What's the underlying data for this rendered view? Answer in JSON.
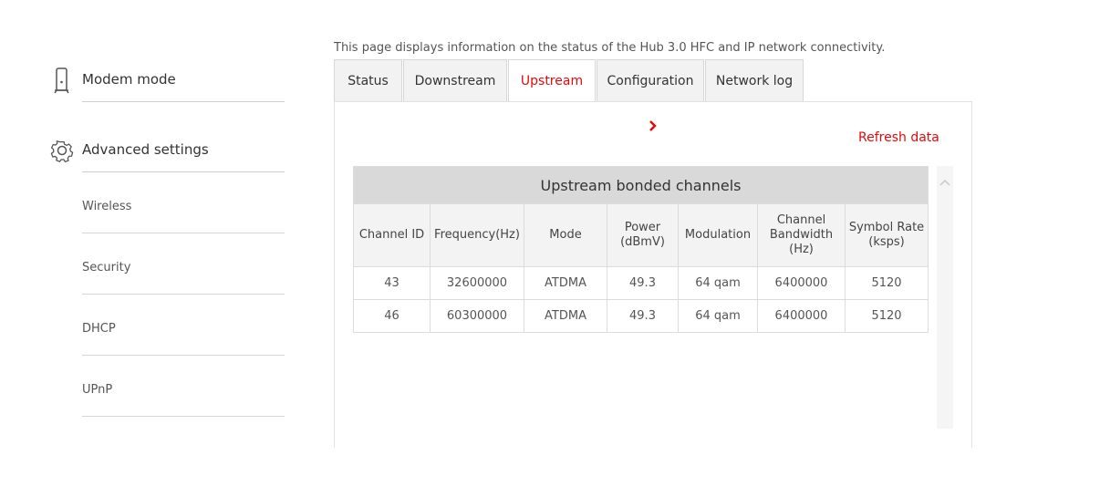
{
  "sidebar": {
    "modem_mode": {
      "label": "Modem mode",
      "icon": "modem-icon"
    },
    "advanced_settings": {
      "label": "Advanced settings",
      "icon": "gear-icon"
    },
    "items": [
      {
        "label": "Wireless"
      },
      {
        "label": "Security"
      },
      {
        "label": "DHCP"
      },
      {
        "label": "UPnP"
      }
    ]
  },
  "intro": "This page displays information on the status of the Hub 3.0 HFC and IP network connectivity.",
  "tabs": [
    {
      "label": "Status"
    },
    {
      "label": "Downstream"
    },
    {
      "label": "Upstream",
      "active": true
    },
    {
      "label": "Configuration"
    },
    {
      "label": "Network log"
    }
  ],
  "refresh_label": "Refresh data",
  "table": {
    "title": "Upstream bonded channels",
    "headers": [
      "Channel ID",
      "Frequency(Hz)",
      "Mode",
      "Power (dBmV)",
      "Modulation",
      "Channel Bandwidth (Hz)",
      "Symbol Rate (ksps)"
    ],
    "rows": [
      [
        "43",
        "32600000",
        "ATDMA",
        "49.3",
        "64 qam",
        "6400000",
        "5120"
      ],
      [
        "46",
        "60300000",
        "ATDMA",
        "49.3",
        "64 qam",
        "6400000",
        "5120"
      ]
    ]
  },
  "colors": {
    "accent": "#e10a0a",
    "header_bg": "#d9d9d9",
    "tab_bg": "#f2f2f2"
  }
}
